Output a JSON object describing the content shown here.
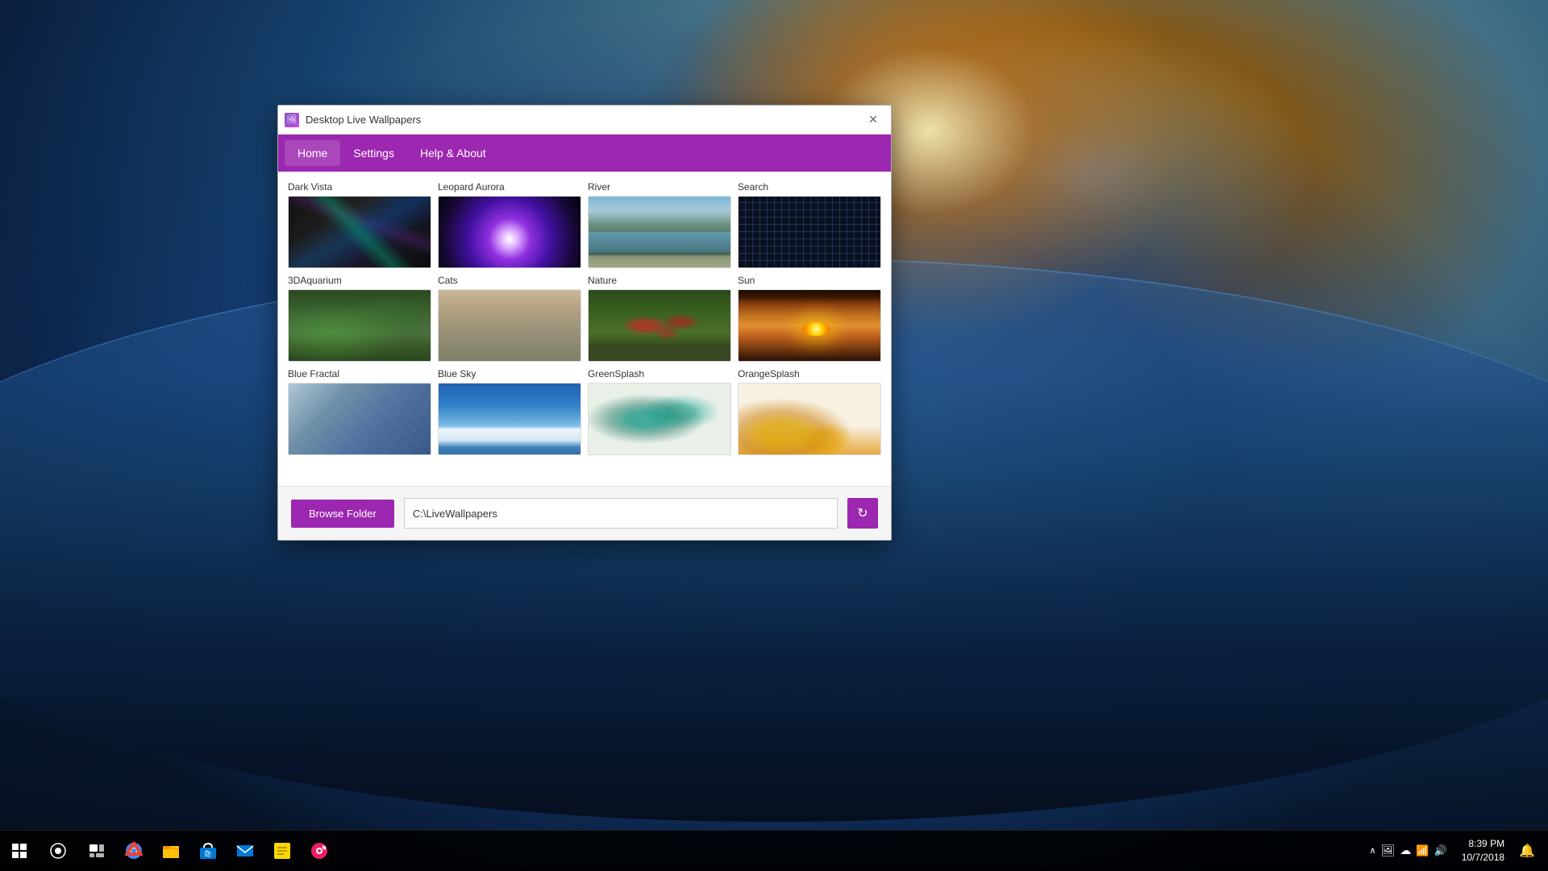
{
  "desktop": {
    "background": "earth from orbit"
  },
  "taskbar": {
    "time": "8:39 PM",
    "date": "10/7/2018",
    "start_icon": "⊞",
    "search_icon": "○",
    "taskview_icon": "▣",
    "apps": [
      {
        "name": "Chrome",
        "icon": "🌐"
      },
      {
        "name": "File Explorer",
        "icon": "📁"
      },
      {
        "name": "Store",
        "icon": "🛍"
      },
      {
        "name": "Mail",
        "icon": "✉"
      },
      {
        "name": "Notes",
        "icon": "📝"
      },
      {
        "name": "Music",
        "icon": "🎵"
      }
    ]
  },
  "window": {
    "title": "Desktop Live Wallpapers",
    "icon": "🖼",
    "close_button": "✕",
    "menu": {
      "items": [
        {
          "label": "Home",
          "active": true
        },
        {
          "label": "Settings",
          "active": false
        },
        {
          "label": "Help & About",
          "active": false
        }
      ]
    },
    "wallpapers": [
      {
        "name": "Dark Vista",
        "thumb_class": "thumb-dark-vista"
      },
      {
        "name": "Leopard Aurora",
        "thumb_class": "thumb-leopard-aurora"
      },
      {
        "name": "River",
        "thumb_class": "thumb-river"
      },
      {
        "name": "Search",
        "thumb_class": "thumb-search"
      },
      {
        "name": "3DAquarium",
        "thumb_class": "thumb-3daquarium"
      },
      {
        "name": "Cats",
        "thumb_class": "thumb-cats"
      },
      {
        "name": "Nature",
        "thumb_class": "thumb-nature"
      },
      {
        "name": "Sun",
        "thumb_class": "thumb-sun"
      },
      {
        "name": "Blue Fractal",
        "thumb_class": "thumb-blue-fractal"
      },
      {
        "name": "Blue Sky",
        "thumb_class": "thumb-blue-sky"
      },
      {
        "name": "GreenSplash",
        "thumb_class": "thumb-greensplash"
      },
      {
        "name": "OrangeSplash",
        "thumb_class": "thumb-orangesplash"
      }
    ],
    "browse_button_label": "Browse Folder",
    "path_value": "C:\\LiveWallpapers",
    "refresh_icon": "↻"
  }
}
